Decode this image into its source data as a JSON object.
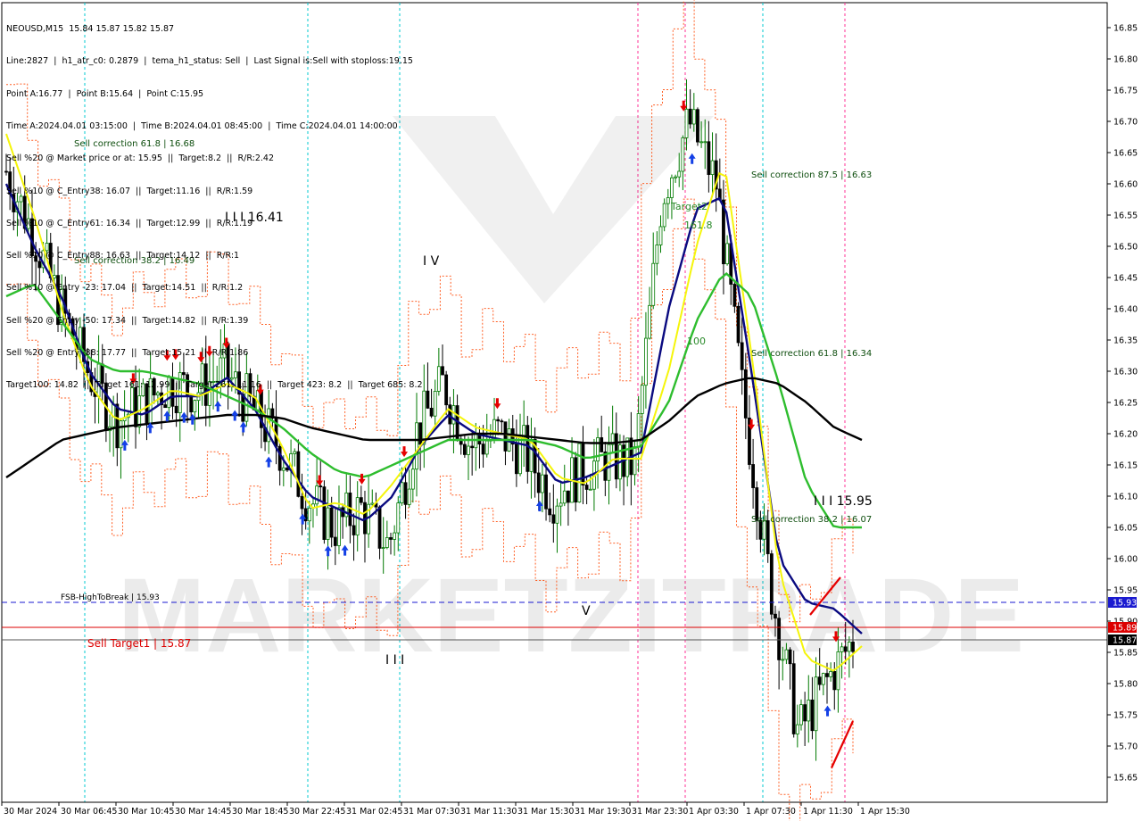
{
  "header": {
    "lines": [
      "NEOUSD,M15  15.84 15.87 15.82 15.87",
      "Line:2827  |  h1_atr_c0: 0.2879  |  tema_h1_status: Sell  |  Last Signal is:Sell with stoploss:19.15",
      "Point A:16.77  |  Point B:15.64  |  Point C:15.95",
      "Time A:2024.04.01 03:15:00  |  Time B:2024.04.01 08:45:00  |  Time C:2024.04.01 14:00:00",
      "Sell %20 @ Market price or at: 15.95  ||  Target:8.2  ||  R/R:2.42",
      "Sell %10 @ C_Entry38: 16.07  ||  Target:11.16  ||  R/R:1.59",
      "Sell %10 @ C_Entry61: 16.34  ||  Target:12.99  ||  R/R:1.19",
      "Sell %10 @ C_Entry88: 16.63  ||  Target:14.12  ||  R/R:1",
      "Sell %10 @ Entry -23: 17.04  ||  Target:14.51  ||  R/R:1.2",
      "Sell %20 @ Entry -50: 17.34  ||  Target:14.82  ||  R/R:1.39",
      "Sell %20 @ Entry -88: 17.77  ||  Target:15.21  ||  R/R:1.86",
      "Target100: 14.82  ||  Target 161: 12.99  ||  Target 261: 11.16  ||  Target 423: 8.2  ||  Target 685: 8.2"
    ]
  },
  "watermark": "MARKETZITRADE",
  "colors": {
    "background": "#ffffff",
    "bull_candle": "#007a00",
    "bear_candle": "#000000",
    "ma_fast": "#0a0a80",
    "ma_yellow": "#f5f50a",
    "ma_green": "#2ebd2e",
    "ma_slow": "#000000",
    "bands": "#ff4500",
    "cyan_line": "#00c8d2",
    "magenta_line": "#ff3296",
    "level_blue": "#1a1ad0",
    "level_red": "#dc0000",
    "sell_arrow": "#e60000",
    "buy_arrow": "#1440e6"
  },
  "chart_data": {
    "type": "candlestick",
    "symbol": "NEOUSD",
    "timeframe": "M15",
    "ylim": [
      15.61,
      16.89
    ],
    "y_ticks": [
      15.65,
      15.7,
      15.75,
      15.8,
      15.85,
      15.9,
      15.95,
      16.0,
      16.05,
      16.1,
      16.15,
      16.2,
      16.25,
      16.3,
      16.35,
      16.4,
      16.45,
      16.5,
      16.55,
      16.6,
      16.65,
      16.7,
      16.75,
      16.8,
      16.85
    ],
    "x_labels": [
      "30 Mar 2024",
      "30 Mar 06:45",
      "30 Mar 10:45",
      "30 Mar 14:45",
      "30 Mar 18:45",
      "30 Mar 22:45",
      "31 Mar 02:45",
      "31 Mar 07:30",
      "31 Mar 11:30",
      "31 Mar 15:30",
      "31 Mar 19:30",
      "31 Mar 23:30",
      "1 Apr 03:30",
      "1 Apr 07:30",
      "1 Apr 11:30",
      "1 Apr 15:30"
    ],
    "price_badges": [
      {
        "value": "15.93",
        "color": "#1a1ad0"
      },
      {
        "value": "15.89",
        "color": "#dc0000"
      },
      {
        "value": "15.87",
        "color": "#000000"
      }
    ],
    "levels": [
      {
        "label": "FSB-HighToBreak | 15.93",
        "value": 15.93,
        "style": "dashed",
        "color": "#1a1ad0"
      },
      {
        "label": "",
        "value": 15.89,
        "style": "solid",
        "color": "#dc0000"
      },
      {
        "label": "",
        "value": 15.87,
        "style": "solid",
        "color": "#555555"
      }
    ],
    "annotations": [
      {
        "text": "Sell correction 61.8 | 16.68",
        "color": "#0d4d0d",
        "size": 10
      },
      {
        "text": "Sell correction 38.2 | 16.49",
        "color": "#0d4d0d",
        "size": 10
      },
      {
        "text": "I I I 16.41",
        "color": "#000000",
        "size": 14
      },
      {
        "text": "I V",
        "color": "#000000",
        "size": 14
      },
      {
        "text": "Sell correction 87.5 | 16.63",
        "color": "#0d4d0d",
        "size": 10
      },
      {
        "text": "Target2",
        "color": "#2a8a2a",
        "size": 11
      },
      {
        "text": "161.8",
        "color": "#2a8a2a",
        "size": 11
      },
      {
        "text": "100",
        "color": "#2a8a2a",
        "size": 11
      },
      {
        "text": "Sell correction 61.8 | 16.34",
        "color": "#0d4d0d",
        "size": 10
      },
      {
        "text": "I I I 15.95",
        "color": "#000000",
        "size": 14
      },
      {
        "text": "Sell correction 38.2 | 16.07",
        "color": "#0d4d0d",
        "size": 10
      },
      {
        "text": "V",
        "color": "#000000",
        "size": 14
      },
      {
        "text": "I I I",
        "color": "#000000",
        "size": 14
      },
      {
        "text": "Sell Target1 | 15.87",
        "color": "#dc0000",
        "size": 12
      }
    ],
    "series": [
      {
        "kind": "close_path",
        "x": [
          "30 Mar 00:00",
          "30 Mar 02:00",
          "30 Mar 04:00",
          "30 Mar 06:45",
          "30 Mar 08:45",
          "30 Mar 10:45",
          "30 Mar 12:45",
          "30 Mar 14:45",
          "30 Mar 16:45",
          "30 Mar 18:45",
          "30 Mar 20:45",
          "30 Mar 22:45",
          "31 Mar 00:45",
          "31 Mar 02:45",
          "31 Mar 04:45",
          "31 Mar 07:30",
          "31 Mar 09:30",
          "31 Mar 11:30",
          "31 Mar 13:30",
          "31 Mar 15:30",
          "31 Mar 17:30",
          "31 Mar 19:30",
          "31 Mar 21:30",
          "31 Mar 23:30",
          "1 Apr 01:30",
          "1 Apr 03:30",
          "1 Apr 05:30",
          "1 Apr 07:30",
          "1 Apr 09:30",
          "1 Apr 11:30",
          "1 Apr 13:30",
          "1 Apr 15:30"
        ],
        "values": [
          16.62,
          16.52,
          16.4,
          16.3,
          16.22,
          16.25,
          16.28,
          16.27,
          16.3,
          16.24,
          16.18,
          16.1,
          16.05,
          16.08,
          16.02,
          16.2,
          16.28,
          16.18,
          16.2,
          16.17,
          16.1,
          16.14,
          16.16,
          16.15,
          16.58,
          16.7,
          16.6,
          16.25,
          15.95,
          15.72,
          15.8,
          15.87
        ]
      },
      {
        "kind": "ma_fast",
        "values": [
          16.6,
          16.5,
          16.42,
          16.3,
          16.24,
          16.23,
          16.26,
          16.26,
          16.29,
          16.24,
          16.16,
          16.1,
          16.08,
          16.06,
          16.1,
          16.18,
          16.23,
          16.2,
          16.19,
          16.18,
          16.12,
          16.13,
          16.15,
          16.17,
          16.4,
          16.56,
          16.58,
          16.3,
          16.0,
          15.93,
          15.92,
          15.88
        ]
      },
      {
        "kind": "ma_yellow",
        "values": [
          16.68,
          16.55,
          16.4,
          16.28,
          16.22,
          16.24,
          16.27,
          16.26,
          16.28,
          16.26,
          16.18,
          16.08,
          16.09,
          16.07,
          16.12,
          16.18,
          16.24,
          16.21,
          16.2,
          16.19,
          16.13,
          16.12,
          16.16,
          16.16,
          16.3,
          16.5,
          16.64,
          16.33,
          15.98,
          15.84,
          15.82,
          15.86
        ]
      },
      {
        "kind": "ma_green",
        "values": [
          16.42,
          16.44,
          16.38,
          16.32,
          16.3,
          16.3,
          16.29,
          16.28,
          16.26,
          16.24,
          16.21,
          16.17,
          16.14,
          16.13,
          16.15,
          16.17,
          16.19,
          16.19,
          16.19,
          16.19,
          16.18,
          16.16,
          16.17,
          16.18,
          16.25,
          16.38,
          16.46,
          16.42,
          16.28,
          16.12,
          16.05,
          16.05
        ]
      },
      {
        "kind": "ma_slow",
        "values": [
          16.13,
          16.16,
          16.19,
          16.2,
          16.21,
          16.215,
          16.22,
          16.225,
          16.23,
          16.23,
          16.225,
          16.21,
          16.2,
          16.19,
          16.19,
          16.19,
          16.195,
          16.2,
          16.2,
          16.195,
          16.19,
          16.185,
          16.185,
          16.19,
          16.22,
          16.26,
          16.28,
          16.29,
          16.28,
          16.25,
          16.21,
          16.19
        ]
      }
    ]
  }
}
